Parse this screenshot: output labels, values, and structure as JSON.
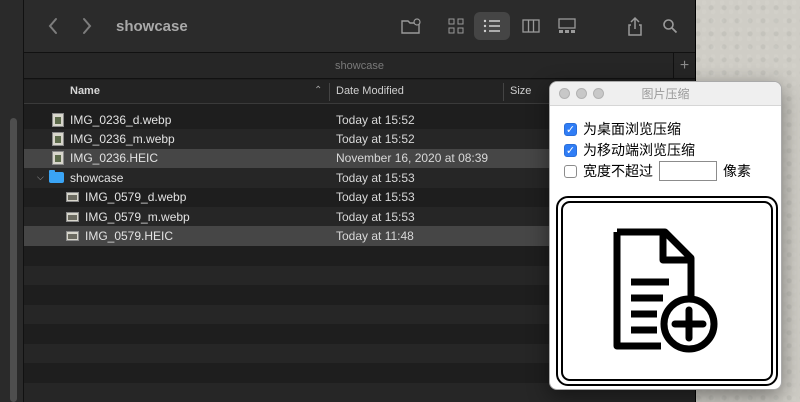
{
  "finder": {
    "title": "showcase",
    "path_label": "showcase",
    "columns": {
      "name": "Name",
      "date": "Date Modified",
      "size": "Size"
    },
    "files": [
      {
        "name": "IMG_0236_d.webp",
        "date": "Today at 15:52",
        "kind": "image-portrait",
        "indent": 1
      },
      {
        "name": "IMG_0236_m.webp",
        "date": "Today at 15:52",
        "kind": "image-portrait",
        "indent": 1
      },
      {
        "name": "IMG_0236.HEIC",
        "date": "November 16, 2020 at 08:39",
        "kind": "image-portrait",
        "indent": 1
      },
      {
        "name": "showcase",
        "date": "Today at 15:53",
        "kind": "folder",
        "indent": 0
      },
      {
        "name": "IMG_0579_d.webp",
        "date": "Today at 15:53",
        "kind": "image-landscape",
        "indent": 2
      },
      {
        "name": "IMG_0579_m.webp",
        "date": "Today at 15:53",
        "kind": "image-landscape",
        "indent": 2
      },
      {
        "name": "IMG_0579.HEIC",
        "date": "Today at 11:48",
        "kind": "image-landscape",
        "indent": 2
      }
    ]
  },
  "compressor": {
    "title": "图片压缩",
    "options": [
      {
        "label": "为桌面浏览压缩",
        "checked": true
      },
      {
        "label": "为移动端浏览压缩",
        "checked": true
      }
    ],
    "width_limit": {
      "prefix": "宽度不超过",
      "value": "",
      "unit": "像素",
      "checked": false
    },
    "drop_icon": "add-document-icon"
  }
}
